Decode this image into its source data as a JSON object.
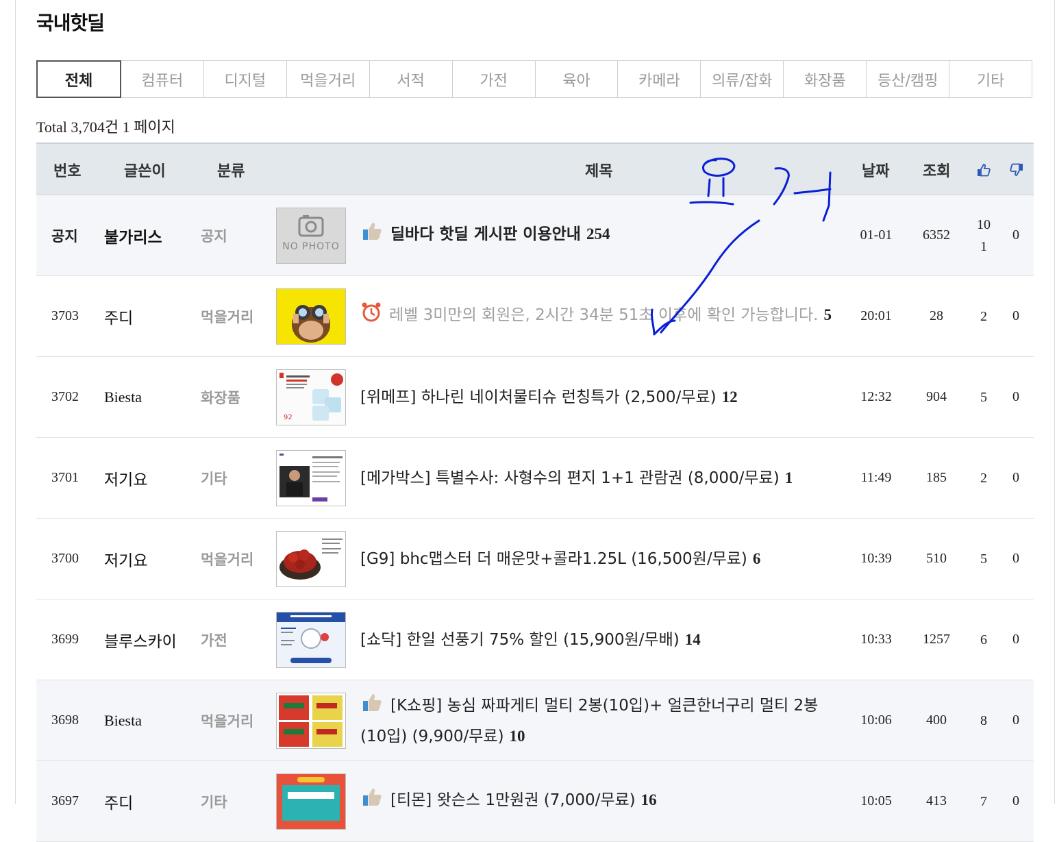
{
  "page": {
    "title": "국내핫딜"
  },
  "tabs": [
    {
      "label": "전체",
      "active": true
    },
    {
      "label": "컴퓨터"
    },
    {
      "label": "디지털"
    },
    {
      "label": "먹을거리"
    },
    {
      "label": "서적"
    },
    {
      "label": "가전"
    },
    {
      "label": "육아"
    },
    {
      "label": "카메라"
    },
    {
      "label": "의류/잡화"
    },
    {
      "label": "화장품"
    },
    {
      "label": "등산/캠핑"
    },
    {
      "label": "기타"
    }
  ],
  "summary": {
    "text": "Total 3,704건 1 페이지"
  },
  "table": {
    "headers": {
      "num": "번호",
      "writer": "글쓴이",
      "category": "분류",
      "title": "제목",
      "date": "날짜",
      "views": "조회",
      "up_icon": "thumbs-up-icon",
      "down_icon": "thumbs-down-icon"
    },
    "rows": [
      {
        "num": "공지",
        "writer": "불가리스",
        "category": "공지",
        "thumb": "NO PHOTO",
        "title": "딜바다 핫딜 게시판 이용안내",
        "comments": "254",
        "date": "01-01",
        "views": "6352",
        "up": "101",
        "down": "0"
      },
      {
        "num": "3703",
        "writer": "주디",
        "category": "먹을거리",
        "thumb": "monkey-binoculars",
        "title": "레벨 3미만의 회원은, 2시간 34분 51초 이후에 확인 가능합니다.",
        "comments": "5",
        "date": "20:01",
        "views": "28",
        "up": "2",
        "down": "0"
      },
      {
        "num": "3702",
        "writer": "Biesta",
        "category": "화장품",
        "thumb": "tissue-ad",
        "title": "[위메프] 하나린 네이처물티슈 런칭특가 (2,500/무료)",
        "comments": "12",
        "date": "12:32",
        "views": "904",
        "up": "5",
        "down": "0"
      },
      {
        "num": "3701",
        "writer": "저기요",
        "category": "기타",
        "thumb": "movie-ticket",
        "title": "[메가박스] 특별수사: 사형수의 편지 1+1 관람권 (8,000/무료)",
        "comments": "1",
        "date": "11:49",
        "views": "185",
        "up": "2",
        "down": "0"
      },
      {
        "num": "3700",
        "writer": "저기요",
        "category": "먹을거리",
        "thumb": "chicken",
        "title": "[G9] bhc맵스터 더 매운맛+콜라1.25L (16,500원/무료)",
        "comments": "6",
        "date": "10:39",
        "views": "510",
        "up": "5",
        "down": "0"
      },
      {
        "num": "3699",
        "writer": "블루스카이",
        "category": "가전",
        "thumb": "fan",
        "title": "[쇼닥] 한일 선풍기 75% 할인 (15,900원/무배)",
        "comments": "14",
        "date": "10:33",
        "views": "1257",
        "up": "6",
        "down": "0"
      },
      {
        "num": "3698",
        "writer": "Biesta",
        "category": "먹을거리",
        "thumb": "ramen",
        "title": "[K쇼핑] 농심 짜파게티 멀티 2봉(10입)+ 얼큰한너구리 멀티 2봉(10입) (9,900/무료)",
        "comments": "10",
        "date": "10:06",
        "views": "400",
        "up": "8",
        "down": "0"
      },
      {
        "num": "3697",
        "writer": "주디",
        "category": "기타",
        "thumb": "coupon",
        "title": "[티몬] 왓슨스 1만원권 (7,000/무료)",
        "comments": "16",
        "date": "10:05",
        "views": "413",
        "up": "7",
        "down": "0"
      }
    ]
  },
  "annotation": {
    "text": "요거",
    "color": "#0a1fd6"
  },
  "colors": {
    "header_bg": "#e3e8ec",
    "shaded_row": "#f4f6f9",
    "muted": "#9a9a9a"
  }
}
